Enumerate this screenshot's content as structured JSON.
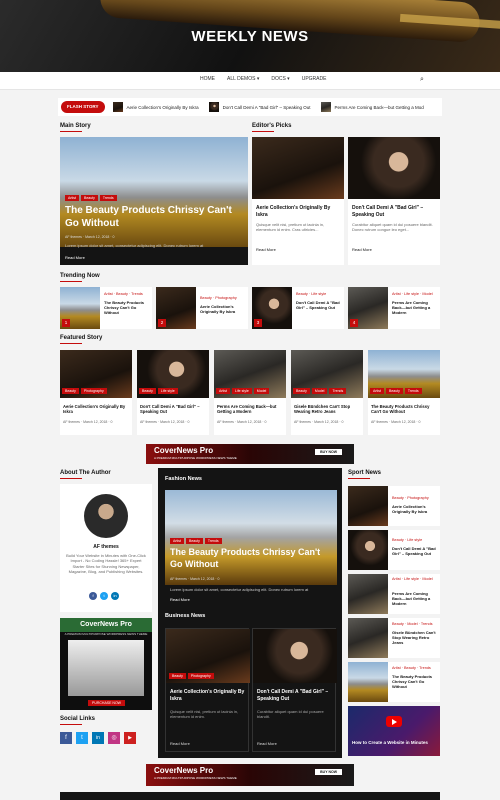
{
  "site": {
    "title": "WEEKLY NEWS"
  },
  "nav": {
    "items": [
      "HOME",
      "ALL DEMOS",
      "DOCS",
      "UPGRADE"
    ]
  },
  "flash": {
    "label": "FLASH STORY",
    "items": [
      "Aerie Collection's Originally By Iskra",
      "Don't Call Demi A \"Bad Girl\" – Speaking Out",
      "Perms Are Coming Back—but Getting a Mod"
    ]
  },
  "main_story": {
    "heading": "Main Story",
    "tags": [
      "Artist",
      "Beauty",
      "Trends"
    ],
    "title": "The Beauty Products Chrissy Can't Go Without",
    "author": "AF themes",
    "date": "March 12, 2018",
    "comments": "0",
    "excerpt": "Lorem ipsum dolor sit amet, consectetur adipiscing elit. Donec rutrum lorem at",
    "read_more": "Read More"
  },
  "editors_picks": {
    "heading": "Editor's Picks",
    "items": [
      {
        "title": "Aerie Collection's Originally By Iskra",
        "excerpt": "Quisque velit nisi, pretium ut lacinia in, elementum id enim. Cras ultricies...",
        "read_more": "Read More"
      },
      {
        "title": "Don't Call Demi A \"Bad Girl\" – Speaking Out",
        "excerpt": "Curabitur aliquet quam id dui posuere blandit. Donec rutrum congue leo eget...",
        "read_more": "Read More"
      }
    ]
  },
  "trending": {
    "heading": "Trending Now",
    "items": [
      {
        "num": "1",
        "cats": "Artist · Beauty · Trends",
        "title": "The Beauty Products Chrissy Can't Go Without"
      },
      {
        "num": "2",
        "cats": "Beauty · Photography",
        "title": "Aerie Collection's Originally By Iskra"
      },
      {
        "num": "3",
        "cats": "Beauty · Life style",
        "title": "Don't Call Demi A \"Bad Girl\" – Speaking Out"
      },
      {
        "num": "4",
        "cats": "Artist · Life style · Model",
        "title": "Perms Are Coming Back—but Getting a Modern"
      }
    ]
  },
  "featured": {
    "heading": "Featured Story",
    "items": [
      {
        "tags": [
          "Beauty",
          "Photography"
        ],
        "title": "Aerie Collection's Originally By Iskra",
        "author": "AF themes",
        "date": "March 12, 2018",
        "comments": "0"
      },
      {
        "tags": [
          "Beauty",
          "Life style"
        ],
        "title": "Don't Call Demi A \"Bad Girl\" – Speaking Out",
        "author": "AF themes",
        "date": "March 12, 2018",
        "comments": "0"
      },
      {
        "tags": [
          "Artist",
          "Life style",
          "Model"
        ],
        "title": "Perms Are Coming Back—but Getting a Modern",
        "author": "AF themes",
        "date": "March 12, 2018",
        "comments": "0"
      },
      {
        "tags": [
          "Beauty",
          "Model",
          "Trends"
        ],
        "title": "Gisele Bündchen Can't Stop Wearing Retro Jeans",
        "author": "AF themes",
        "date": "March 12, 2018",
        "comments": "0"
      },
      {
        "tags": [
          "Artist",
          "Beauty",
          "Trends"
        ],
        "title": "The Beauty Products Chrissy Can't Go Without",
        "author": "AF themes",
        "date": "March 12, 2018",
        "comments": "0"
      }
    ]
  },
  "ad": {
    "title": "CoverNews Pro",
    "subtitle": "A PREMIUM MULTIPURPOSE WORDPRESS NEWS THEME",
    "button": "BUY NOW"
  },
  "about": {
    "heading": "About The Author",
    "name": "AF themes",
    "bio": "Build Your Website in Minutes with One-Click Import - No Coding Hassle! 365+ Expert Starter Sites for Stunning Newspaper, Magazine, Blog, and Publishing Websites."
  },
  "side_ad": {
    "title": "CoverNews Pro",
    "subtitle": "A PREMIUM MULTIPURPOSE WORDPRESS NEWS THEME",
    "button": "PURCHASE NOW"
  },
  "social": {
    "heading": "Social Links",
    "icons": [
      "f",
      "t",
      "in",
      "◎",
      "▶"
    ]
  },
  "fashion": {
    "heading": "Fashion News",
    "tags": [
      "Artist",
      "Beauty",
      "Trends"
    ],
    "title": "The Beauty Products Chrissy Can't Go Without",
    "author": "AF themes",
    "date": "March 12, 2018",
    "comments": "0",
    "excerpt": "Lorem ipsum dolor sit amet, consectetur adipiscing elit. Donec rutrum lorem at",
    "read_more": "Read More"
  },
  "business": {
    "heading": "Business News",
    "items": [
      {
        "tags": [
          "Beauty",
          "Photography"
        ],
        "title": "Aerie Collection's Originally By Iskra",
        "excerpt": "Quisque velit nisi, pretium ut lacinia in, elementum id enim.",
        "read_more": "Read More"
      },
      {
        "tags": [],
        "title": "Don't Call Demi A \"Bad Girl\" – Speaking Out",
        "excerpt": "Curabitur aliquet quam id dui posuere blandit.",
        "read_more": "Read More"
      }
    ]
  },
  "sport": {
    "heading": "Sport News",
    "items": [
      {
        "cats": "Beauty · Photography",
        "title": "Aerie Collection's Originally By Iskra"
      },
      {
        "cats": "Beauty · Life style",
        "title": "Don't Call Demi A \"Bad Girl\" – Speaking Out"
      },
      {
        "cats": "Artist · Life style · Model",
        "title": "Perms Are Coming Back—but Getting a Modern"
      },
      {
        "cats": "Beauty · Model · Trends",
        "title": "Gisele Bündchen Can't Stop Wearing Retro Jeans"
      },
      {
        "cats": "Artist · Beauty · Trends",
        "title": "The Beauty Products Chrissy Can't Go Without"
      }
    ],
    "video_title": "How to Create a Website in Minutes"
  },
  "colors": {
    "accent": "#c40c0c",
    "dark": "#141414"
  }
}
